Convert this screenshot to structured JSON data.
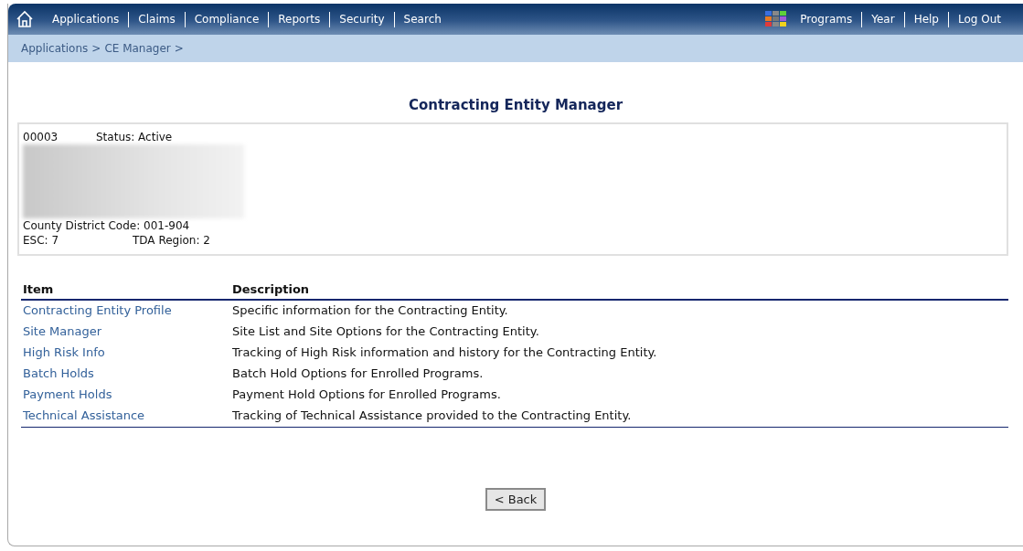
{
  "nav": {
    "left": [
      "Applications",
      "Claims",
      "Compliance",
      "Reports",
      "Security",
      "Search"
    ],
    "right": [
      "Programs",
      "Year",
      "Help",
      "Log Out"
    ]
  },
  "breadcrumb": [
    {
      "label": "Applications",
      "separator": ">"
    },
    {
      "label": "CE Manager",
      "separator": ">"
    }
  ],
  "title": "Contracting Entity Manager",
  "entity": {
    "id": "00003",
    "status": "Status: Active",
    "district": "County District Code: 001-904",
    "esc": "ESC: 7",
    "region": "TDA Region: 2"
  },
  "table": {
    "columns": [
      "Item",
      "Description"
    ],
    "rows": [
      {
        "item": "Contracting Entity Profile",
        "description": "Specific information for the Contracting Entity."
      },
      {
        "item": "Site Manager",
        "description": "Site List and Site Options for the Contracting Entity."
      },
      {
        "item": "High Risk Info",
        "description": "Tracking of High Risk information and history for the Contracting Entity."
      },
      {
        "item": "Batch Holds",
        "description": "Batch Hold Options for Enrolled Programs."
      },
      {
        "item": "Payment Holds",
        "description": "Payment Hold Options for Enrolled Programs."
      },
      {
        "item": "Technical Assistance",
        "description": "Tracking of Technical Assistance provided to the Contracting Entity."
      }
    ]
  },
  "back_button": "< Back"
}
